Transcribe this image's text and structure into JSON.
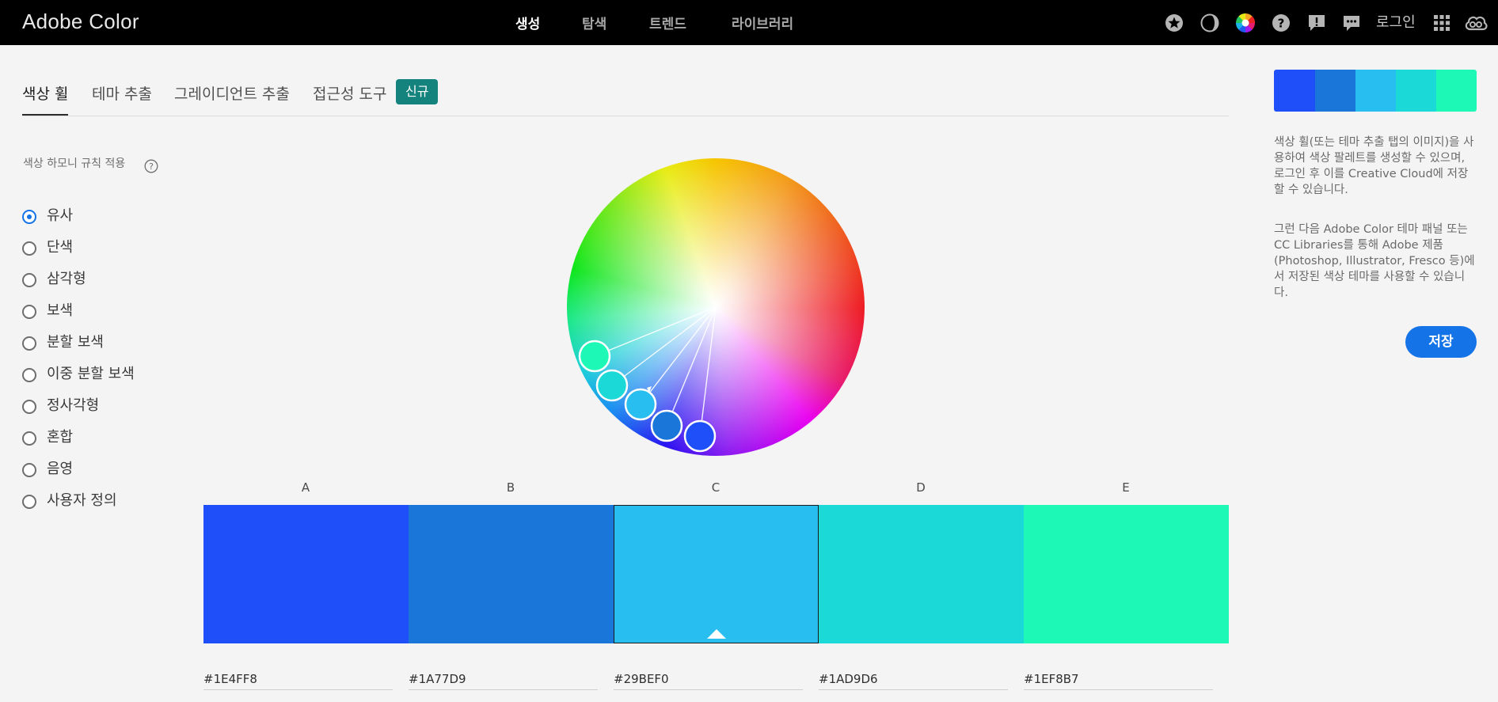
{
  "app": {
    "brand": "Adobe Color",
    "login": "로그인"
  },
  "nav": [
    {
      "label": "생성",
      "active": true
    },
    {
      "label": "탐색",
      "active": false
    },
    {
      "label": "트렌드",
      "active": false
    },
    {
      "label": "라이브러리",
      "active": false
    }
  ],
  "toolbar_icons": [
    "star-icon",
    "contrast-icon",
    "color-wheel-icon",
    "help-icon",
    "feedback-icon",
    "chat-icon",
    "apps-grid-icon",
    "creative-cloud-icon"
  ],
  "tabs": [
    {
      "label": "색상 휠",
      "active": true
    },
    {
      "label": "테마 추출",
      "active": false
    },
    {
      "label": "그레이디언트 추출",
      "active": false
    },
    {
      "label": "접근성 도구",
      "active": false
    }
  ],
  "new_badge": "신규",
  "harmony": {
    "title": "색상 하모니 규칙 적용",
    "rules": [
      {
        "label": "유사",
        "checked": true
      },
      {
        "label": "단색",
        "checked": false
      },
      {
        "label": "삼각형",
        "checked": false
      },
      {
        "label": "보색",
        "checked": false
      },
      {
        "label": "분할 보색",
        "checked": false
      },
      {
        "label": "이중 분할 보색",
        "checked": false
      },
      {
        "label": "정사각형",
        "checked": false
      },
      {
        "label": "혼합",
        "checked": false
      },
      {
        "label": "음영",
        "checked": false
      },
      {
        "label": "사용자 정의",
        "checked": false
      }
    ]
  },
  "swatches": [
    {
      "label": "A",
      "hex": "#1E4FF8",
      "color": "#1E4FF8",
      "selected": false
    },
    {
      "label": "B",
      "hex": "#1A77D9",
      "color": "#1A77D9",
      "selected": false
    },
    {
      "label": "C",
      "hex": "#29BEF0",
      "color": "#29BEF0",
      "selected": true
    },
    {
      "label": "D",
      "hex": "#1AD9D6",
      "color": "#1AD9D6",
      "selected": false
    },
    {
      "label": "E",
      "hex": "#1EF8B7",
      "color": "#1EF8B7",
      "selected": false
    }
  ],
  "info": {
    "para1": "색상 휠(또는 테마 추출 탭의 이미지)을 사용하여 색상 팔레트를 생성할 수 있으며, 로그인 후 이를 Creative Cloud에 저장할 수 있습니다.",
    "para2": "그런 다음 Adobe Color 테마 패널 또는 CC Libraries를 통해 Adobe 제품(Photoshop, Illustrator, Fresco 등)에서 저장된 색상 테마를 사용할 수 있습니다."
  },
  "save_label": "저장",
  "colors": {
    "accent": "#1473e6",
    "badge": "#14837e",
    "topbar": "#000000"
  }
}
